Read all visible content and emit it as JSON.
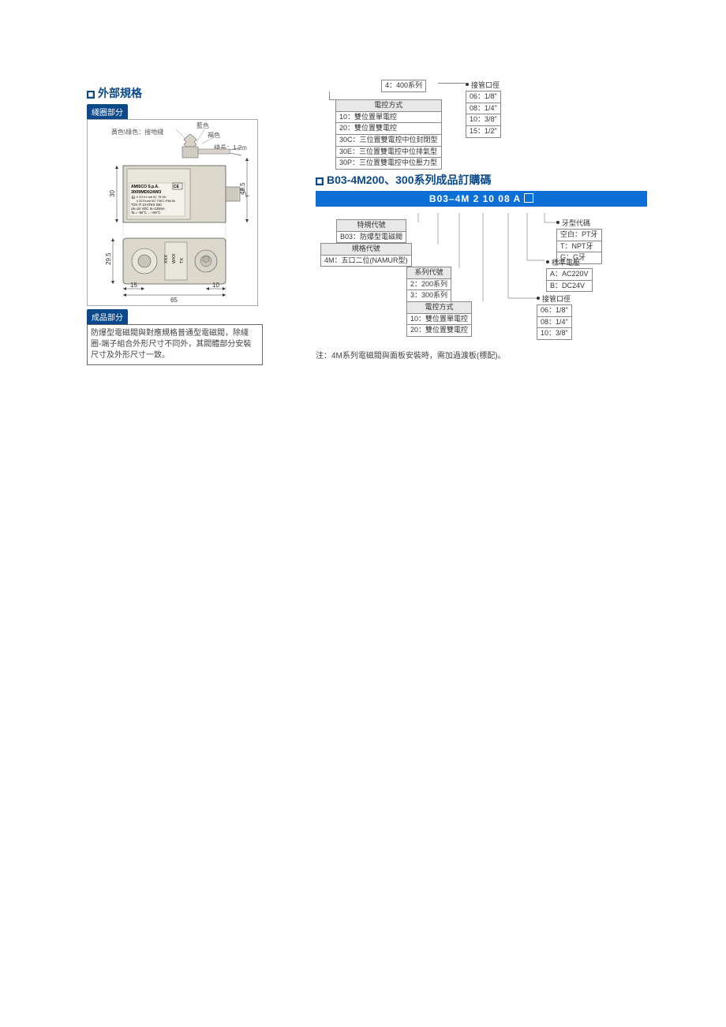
{
  "left": {
    "title": "外部規格",
    "sub1": "綫圈部分",
    "sub2": "成品部分",
    "wires": {
      "yellow_green": "黃色\\綠色：接地綫",
      "blue": "藍色",
      "brown": "褐色",
      "len": "綫長：1.2m"
    },
    "label_block": {
      "l1": "AMISCO S.p.A.",
      "l2": "3009MD024W3",
      "l3": "II 2G Ex mb IIC T5 Gb",
      "l4": "II 2D Ex mb IIIC T95°C IP66 Db",
      "l5": "TÜV IT 13 ATEX 030",
      "l6": "Un=24 VDC  In=125mA",
      "l7": "Ta = -50°C ... +50°C"
    },
    "dims": {
      "w": "65",
      "h": "49.5",
      "d": "30",
      "d2": "29.5",
      "a": "15",
      "b": "10"
    },
    "body_text": "防爆型電磁閥與對應規格普通型電磁閥，除綫圈-端子組合外形尺寸不同外，其閥體部分安裝尺寸及外形尺寸一致。"
  },
  "top_right": {
    "series": {
      "label": "4：400系列"
    },
    "method_hdr": "電控方式",
    "method": [
      "10：雙位置單電控",
      "20：雙位置雙電控",
      "30C：三位置雙電控中位封閉型",
      "30E：三位置雙電控中位排氣型",
      "30P：三位置雙電控中位壓力型"
    ],
    "port_hdr": "接管口徑",
    "port": [
      "06：1/8\"",
      "08：1/4\"",
      "10：3/8\"",
      "15：1/2\""
    ]
  },
  "mid": {
    "title": "B03-4M200、300系列成品訂購碼",
    "code": "B03–4M 2 10 08 A",
    "groups": {
      "special_hdr": "特規代號",
      "special": [
        "B03：防爆型電磁閥"
      ],
      "spec_hdr": "規格代號",
      "spec": [
        "4M：五口二位(NAMUR型)"
      ],
      "series_hdr": "系列代號",
      "series": [
        "2：200系列",
        "3：300系列"
      ],
      "method_hdr": "電控方式",
      "method": [
        "10：雙位置單電控",
        "20：雙位置雙電控"
      ],
      "thread_hdr": "牙型代碼",
      "thread": [
        "空白：PT牙",
        "T：NPT牙",
        "G：G牙"
      ],
      "volt_hdr": "標準電壓",
      "volt": [
        "A：AC220V",
        "B：DC24V"
      ],
      "port_hdr": "接管口徑",
      "port": [
        "06：1/8\"",
        "08：1/4\"",
        "10：3/8\""
      ]
    },
    "note": "注：4M系列電磁閥與面板安裝時，需加過渡板(標配)。"
  }
}
